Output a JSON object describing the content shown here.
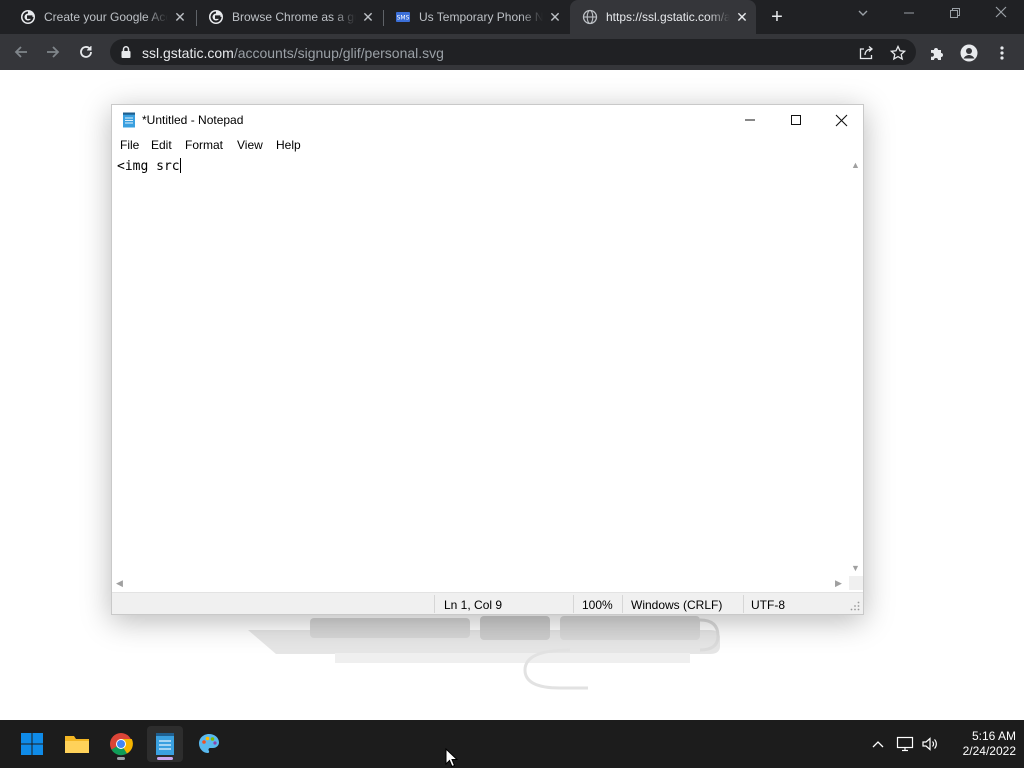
{
  "browser": {
    "tabs": [
      {
        "title": "Create your Google Account",
        "favicon": "google-g-icon",
        "active": false
      },
      {
        "title": "Browse Chrome as a guest",
        "favicon": "google-g-icon",
        "active": false
      },
      {
        "title": "Us Temporary Phone Numbers",
        "favicon": "sms-icon",
        "active": false
      },
      {
        "title": "https://ssl.gstatic.com/accounts/signup/glif/personal.svg",
        "favicon": "globe-icon",
        "active": true
      }
    ],
    "address": {
      "host": "ssl.gstatic.com",
      "path": "/accounts/signup/glif/personal.svg"
    }
  },
  "notepad": {
    "title": "*Untitled - Notepad",
    "menu": [
      "File",
      "Edit",
      "Format",
      "View",
      "Help"
    ],
    "content": "<img src",
    "status": {
      "position": "Ln 1, Col 9",
      "zoom": "100%",
      "line_ending": "Windows (CRLF)",
      "encoding": "UTF-8"
    }
  },
  "taskbar": {
    "apps": [
      "start-icon",
      "file-explorer-icon",
      "chrome-icon",
      "notepad-icon",
      "paint-icon"
    ],
    "time": "5:16 AM",
    "date": "2/24/2022"
  },
  "colors": {
    "chrome_frame": "#202124",
    "chrome_toolbar": "#35363a",
    "taskbar": "#1c1c1c",
    "windows_accent": "#0078d4"
  }
}
